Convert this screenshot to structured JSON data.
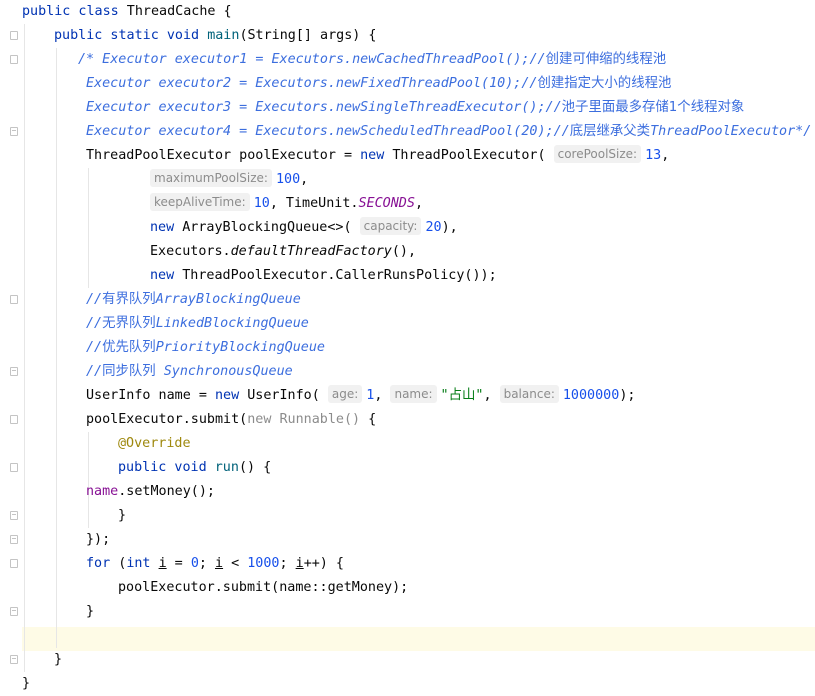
{
  "editor": {
    "hints": {
      "core_pool_size": "corePoolSize:",
      "maximum_pool_size": "maximumPoolSize:",
      "keep_alive_time": "keepAliveTime:",
      "capacity": "capacity:",
      "age": "age:",
      "name": "name:",
      "balance": "balance:"
    },
    "lines": {
      "l1": {
        "kw": "public class",
        "name": " ThreadCache {"
      },
      "l2": {
        "kw": "public static void",
        "fn": "main",
        "rest": "(String[] args) {"
      },
      "l3": {
        "text": "/* Executor executor1 = Executors.newCachedThreadPool();//",
        "cjk": "创建可伸缩的线程池"
      },
      "l4": {
        "text": "Executor executor2 = Executors.newFixedThreadPool(10);//",
        "cjk": "创建指定大小的线程池"
      },
      "l5": {
        "text": "Executor executor3 = Executors.newSingleThreadExecutor();//",
        "cjk": "池子里面最多存储1个线程对象"
      },
      "l6": {
        "text": "Executor executor4 = Executors.newScheduledThreadPool(20);//",
        "cjk": "底层继承父类",
        "tail": "ThreadPoolExecutor*/"
      },
      "l7": {
        "a": "ThreadPoolExecutor poolExecutor = ",
        "kw": "new",
        "b": " ThreadPoolExecutor(",
        "num": "13",
        "c": ","
      },
      "l8": {
        "num": "100",
        "c": ","
      },
      "l9": {
        "num": "10",
        "a": ", TimeUnit.",
        "field": "SECONDS",
        "c": ","
      },
      "l10": {
        "kw": "new",
        "a": " ArrayBlockingQueue<>(",
        "num": "20",
        "c": "),"
      },
      "l11": {
        "a": "Executors.",
        "stat": "defaultThreadFactory",
        "c": "(),"
      },
      "l12": {
        "kw": "new",
        "a": " ThreadPoolExecutor.CallerRunsPolicy());"
      },
      "l13": {
        "prefix": "//",
        "cjk": "有界队列",
        "tail": "ArrayBlockingQueue"
      },
      "l14": {
        "prefix": "//",
        "cjk": "无界队列",
        "tail": "LinkedBlockingQueue"
      },
      "l15": {
        "prefix": "//",
        "cjk": "优先队列",
        "tail": "PriorityBlockingQueue"
      },
      "l16": {
        "prefix": "//",
        "cjk": "同步队列",
        "tail": " SynchronousQueue"
      },
      "l17": {
        "a": "UserInfo name = ",
        "kw": "new",
        "b": " UserInfo(",
        "num1": "1",
        "c1": ",",
        "str": "\"占山\"",
        "c2": ",",
        "num2": "1000000",
        "c3": ");"
      },
      "l18": {
        "a": "poolExecutor.submit(",
        "gray": "new Runnable()",
        "b": " {"
      },
      "l19": {
        "ann": "@Override"
      },
      "l20": {
        "kw": "public void",
        "fn": "run",
        "rest": "() {"
      },
      "l21": {
        "param": "name",
        "rest": ".setMoney();"
      },
      "l22": {
        "text": "}"
      },
      "l23": {
        "text": "});"
      },
      "l24": {
        "kw": "for",
        "a": " (",
        "kw2": "int",
        "sp": " ",
        "v1": "i",
        "b": " = ",
        "n1": "0",
        "c": "; ",
        "v2": "i",
        "d": " < ",
        "n2": "1000",
        "e": "; ",
        "v3": "i",
        "f": "++) {"
      },
      "l25": {
        "text": "poolExecutor.submit(name::getMoney);"
      },
      "l26": {
        "text": "}"
      },
      "l28": {
        "text": "}"
      },
      "l29": {
        "text": "}"
      }
    }
  }
}
